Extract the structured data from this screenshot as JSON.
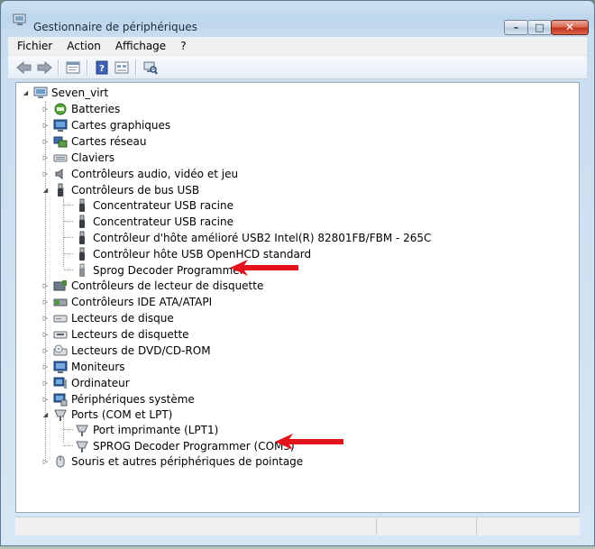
{
  "window": {
    "title": "Gestionnaire de périphériques",
    "minimize_glyph": "–",
    "maximize_glyph": "□",
    "close_glyph": "✕"
  },
  "menubar": {
    "items": [
      "Fichier",
      "Action",
      "Affichage",
      "?"
    ]
  },
  "toolbar": {
    "buttons": [
      "back-icon",
      "forward-icon",
      "properties-icon",
      "help-icon",
      "view-icon",
      "scan-hardware-icon"
    ]
  },
  "tree": {
    "root": "Seven_virt",
    "categories": [
      {
        "label": "Batteries",
        "icon": "battery-icon",
        "expanded": false
      },
      {
        "label": "Cartes graphiques",
        "icon": "display-adapter-icon",
        "expanded": false
      },
      {
        "label": "Cartes réseau",
        "icon": "network-adapter-icon",
        "expanded": false
      },
      {
        "label": "Claviers",
        "icon": "keyboard-icon",
        "expanded": false
      },
      {
        "label": "Contrôleurs audio, vidéo et jeu",
        "icon": "speaker-icon",
        "expanded": false
      },
      {
        "label": "Contrôleurs de bus USB",
        "icon": "usb-icon",
        "expanded": true,
        "children": [
          "Concentrateur USB racine",
          "Concentrateur USB racine",
          "Contrôleur d'hôte amélioré USB2 Intel(R) 82801FB/FBM - 265C",
          "Contrôleur hôte USB OpenHCD standard",
          "Sprog Decoder Programmer"
        ]
      },
      {
        "label": "Contrôleurs de lecteur de disquette",
        "icon": "floppy-controller-icon",
        "expanded": false
      },
      {
        "label": "Contrôleurs IDE ATA/ATAPI",
        "icon": "ide-controller-icon",
        "expanded": false
      },
      {
        "label": "Lecteurs de disque",
        "icon": "disk-drive-icon",
        "expanded": false
      },
      {
        "label": "Lecteurs de disquette",
        "icon": "floppy-drive-icon",
        "expanded": false
      },
      {
        "label": "Lecteurs de DVD/CD-ROM",
        "icon": "dvd-drive-icon",
        "expanded": false
      },
      {
        "label": "Moniteurs",
        "icon": "monitor-icon",
        "expanded": false
      },
      {
        "label": "Ordinateur",
        "icon": "computer-icon",
        "expanded": false
      },
      {
        "label": "Périphériques système",
        "icon": "system-devices-icon",
        "expanded": false
      },
      {
        "label": "Ports (COM et LPT)",
        "icon": "port-icon",
        "expanded": true,
        "children": [
          "Port imprimante (LPT1)",
          "SPROG Decoder Programmer (COM3)"
        ]
      },
      {
        "label": "Souris et autres périphériques de pointage",
        "icon": "mouse-icon",
        "expanded": false
      }
    ]
  },
  "colors": {
    "annotation_arrow": "#e3141b",
    "tree_background": "#ffffff",
    "window_frame": "#c9ddef"
  }
}
